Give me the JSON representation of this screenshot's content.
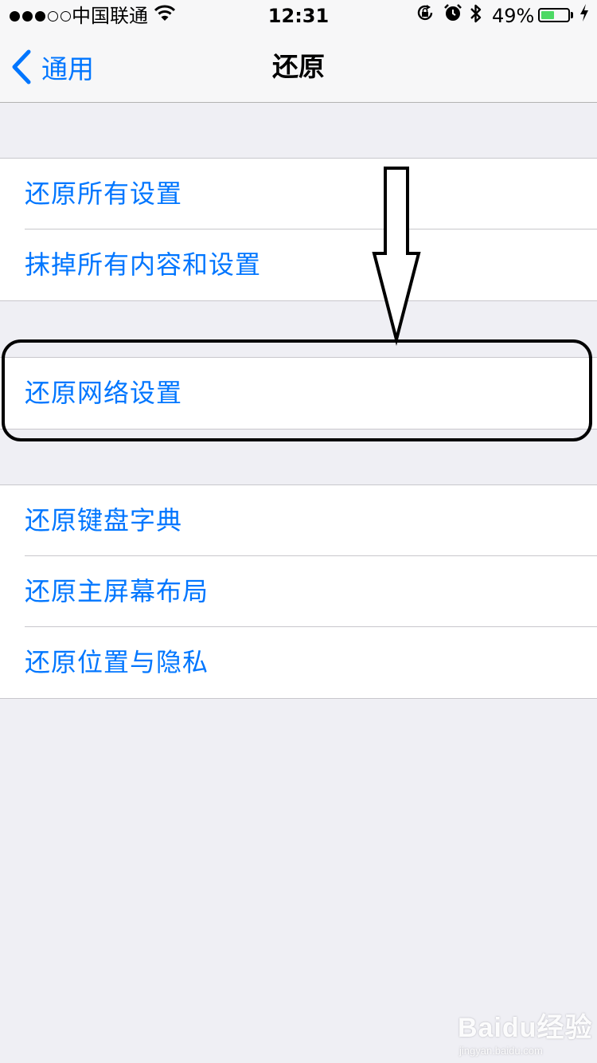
{
  "status_bar": {
    "signal_dots": "●●●○○",
    "carrier": "中国联通",
    "time": "12:31",
    "battery_percent": "49%",
    "battery_level": 0.49,
    "battery_color": "#4cd964",
    "icons": [
      "wifi-icon",
      "rotation-lock-icon",
      "alarm-icon",
      "bluetooth-icon",
      "battery-icon",
      "charging-bolt-icon"
    ]
  },
  "nav": {
    "back_label": "通用",
    "title": "还原",
    "tint_color": "#0076ff"
  },
  "groups": [
    {
      "items": [
        {
          "label": "还原所有设置"
        },
        {
          "label": "抹掉所有内容和设置"
        }
      ]
    },
    {
      "items": [
        {
          "label": "还原网络设置"
        }
      ]
    },
    {
      "items": [
        {
          "label": "还原键盘字典"
        },
        {
          "label": "还原主屏幕布局"
        },
        {
          "label": "还原位置与隐私"
        }
      ]
    }
  ],
  "watermark": {
    "text": "Baidu经验",
    "sub": "jingyan.baidu.com"
  }
}
